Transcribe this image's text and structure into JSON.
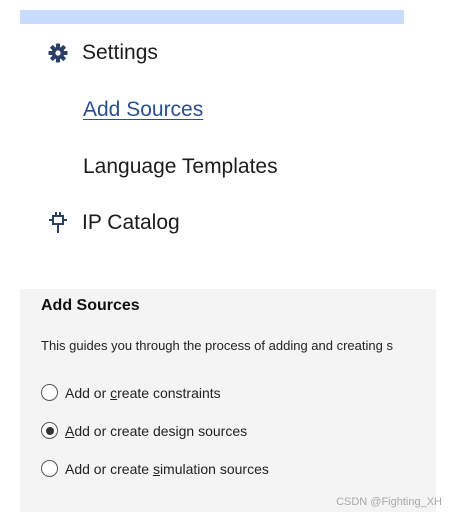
{
  "nav": {
    "settings": {
      "label": "Settings",
      "icon": "gear-icon"
    },
    "add_sources": {
      "label": "Add Sources"
    },
    "language_templates": {
      "label": "Language Templates"
    },
    "ip_catalog": {
      "label": "IP Catalog",
      "icon": "ip-catalog-icon"
    }
  },
  "panel": {
    "title": "Add Sources",
    "description": "This guides you through the process of adding and creating s",
    "options": [
      {
        "pre": "Add or ",
        "mnemonic": "c",
        "post": "reate constraints",
        "checked": false
      },
      {
        "pre": "",
        "mnemonic": "A",
        "post": "dd or create design sources",
        "checked": true
      },
      {
        "pre": "Add or create ",
        "mnemonic": "s",
        "post": "imulation sources",
        "checked": false
      }
    ]
  },
  "watermark": "CSDN @Fighting_XH",
  "colors": {
    "top_strip": "#c9dcfb",
    "link": "#2a4f90",
    "panel_bg": "#f4f4f4"
  }
}
